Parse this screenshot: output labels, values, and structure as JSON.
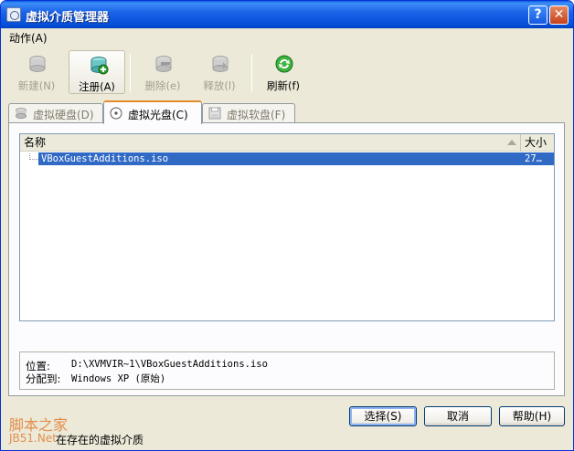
{
  "window": {
    "title": "虚拟介质管理器",
    "help_glyph": "?",
    "close_glyph": "✕"
  },
  "menu": {
    "action_label": "动作(A)"
  },
  "toolbar": {
    "new_label": "新建(N)",
    "register_label": "注册(A)",
    "remove_label": "删除(e)",
    "release_label": "释放(l)",
    "refresh_label": "刷新(f)"
  },
  "tabs": [
    {
      "label": "虚拟硬盘(D)",
      "state": "inactive"
    },
    {
      "label": "虚拟光盘(C)",
      "state": "active"
    },
    {
      "label": "虚拟软盘(F)",
      "state": "inactive"
    }
  ],
  "listview": {
    "columns": [
      "名称",
      "大小"
    ],
    "rows": [
      {
        "name": "VBoxGuestAdditions.iso",
        "size": "27…",
        "selected": true
      }
    ]
  },
  "info": {
    "location_label": "位置:",
    "location_value": "D:\\XVMVIR~1\\VBoxGuestAdditions.iso",
    "attached_label": "分配到:",
    "attached_value": "Windows XP (原始)"
  },
  "buttons": {
    "select_label": "选择(S)",
    "cancel_label": "取消",
    "help_label": "帮助(H)"
  },
  "status": {
    "watermark_line1": "脚本之家",
    "watermark_line2": "JB51.Net",
    "text": "在存在的虚拟介质"
  },
  "colors": {
    "titlebar": "#0550D8",
    "selection": "#316ac5",
    "active_tab_accent": "#e68b2c"
  }
}
